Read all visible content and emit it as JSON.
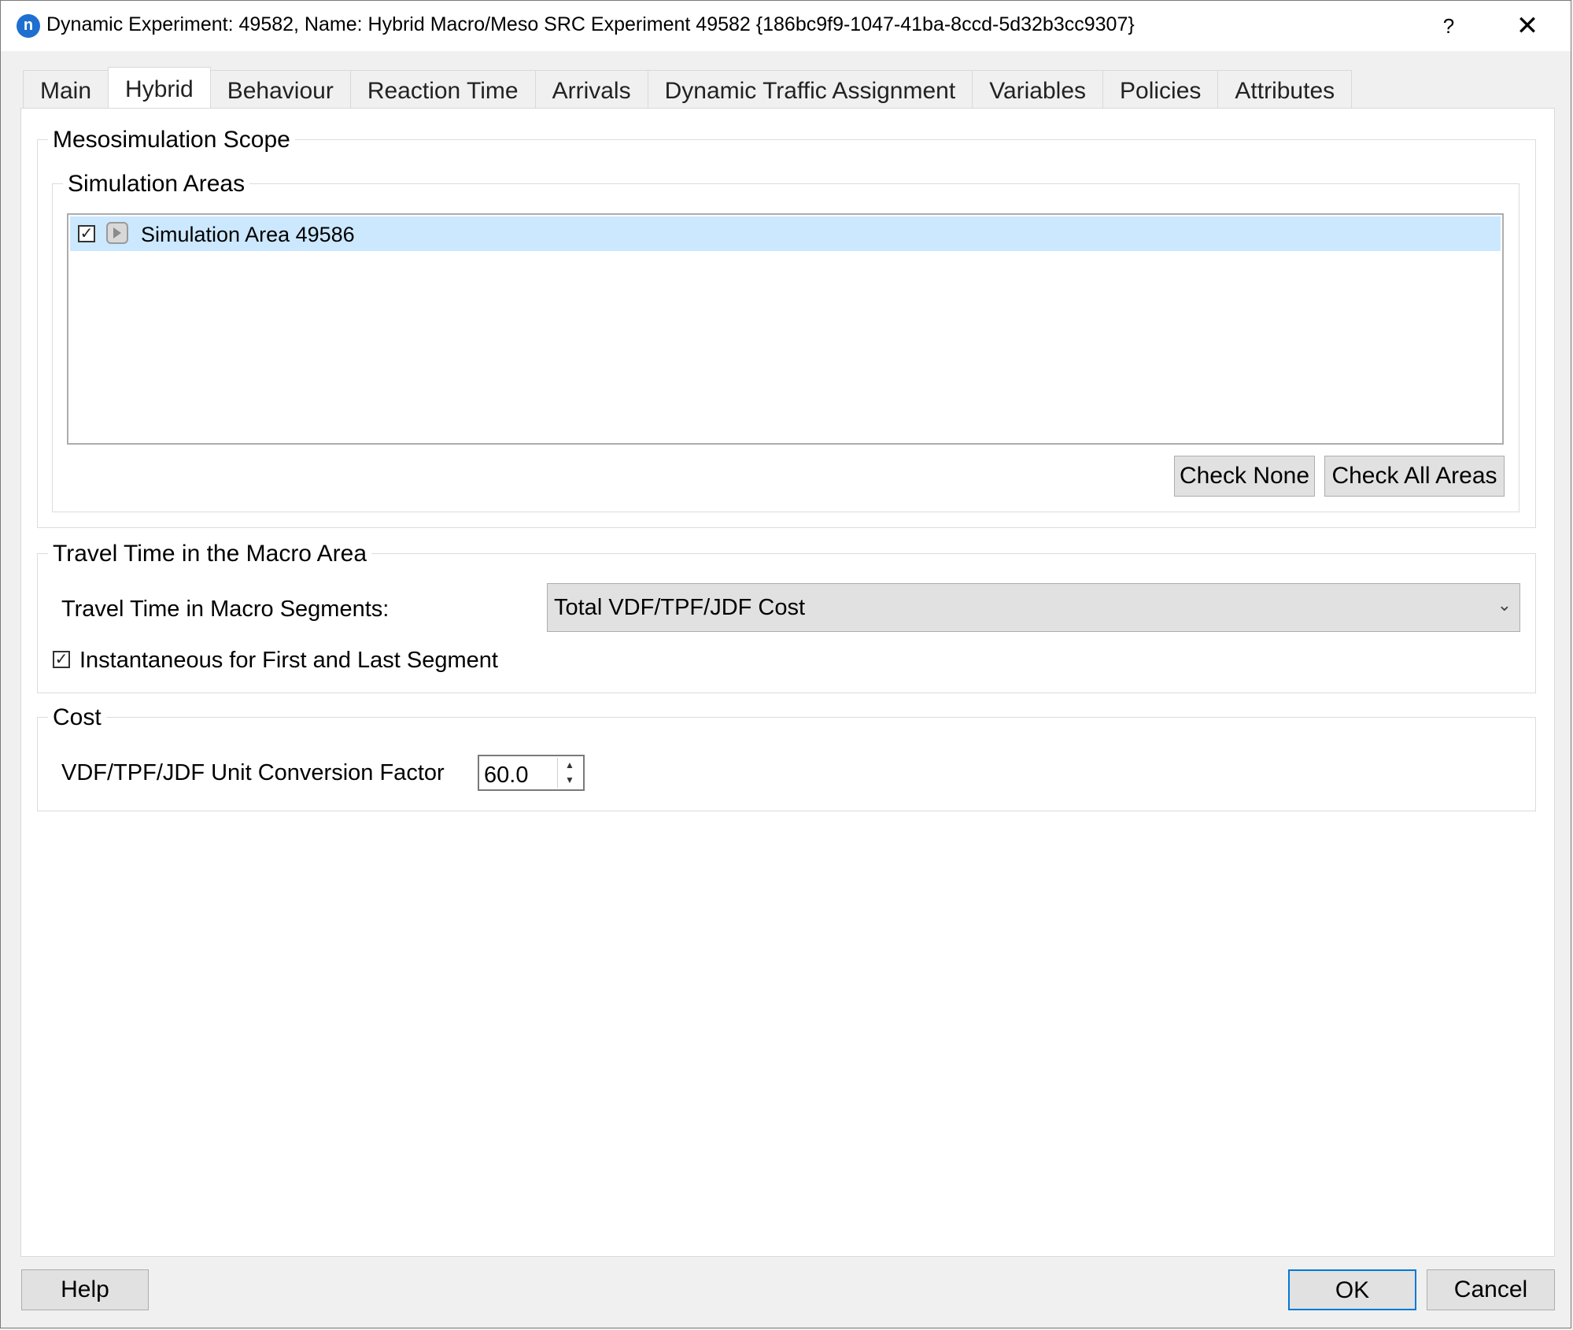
{
  "window": {
    "title": "Dynamic Experiment: 49582, Name: Hybrid Macro/Meso SRC Experiment 49582  {186bc9f9-1047-41ba-8ccd-5d32b3cc9307}",
    "app_icon_glyph": "n",
    "help_glyph": "?",
    "close_glyph": "✕"
  },
  "tabs": [
    {
      "label": "Main",
      "active": false
    },
    {
      "label": "Hybrid",
      "active": true
    },
    {
      "label": "Behaviour",
      "active": false
    },
    {
      "label": "Reaction Time",
      "active": false
    },
    {
      "label": "Arrivals",
      "active": false
    },
    {
      "label": "Dynamic Traffic Assignment",
      "active": false
    },
    {
      "label": "Variables",
      "active": false
    },
    {
      "label": "Policies",
      "active": false
    },
    {
      "label": "Attributes",
      "active": false
    }
  ],
  "meso_scope": {
    "title": "Mesosimulation Scope",
    "areas": {
      "title": "Simulation Areas",
      "items": [
        {
          "label": "Simulation Area 49586",
          "checked": true,
          "selected": true,
          "check_glyph": "✓"
        }
      ],
      "check_none_label": "Check None",
      "check_all_label": "Check All Areas"
    }
  },
  "travel_time": {
    "title": "Travel Time in the Macro Area",
    "macro_segments_label": "Travel Time in Macro Segments:",
    "macro_segments_value": "Total VDF/TPF/JDF Cost",
    "combo_arrow_glyph": "⌄",
    "instantaneous_label": "Instantaneous for First and Last Segment",
    "instantaneous_checked": true,
    "check_glyph": "✓"
  },
  "cost": {
    "title": "Cost",
    "conversion_label": "VDF/TPF/JDF Unit Conversion Factor",
    "conversion_value": "60.0",
    "spin_up_glyph": "▲",
    "spin_down_glyph": "▼"
  },
  "footer": {
    "help_label": "Help",
    "ok_label": "OK",
    "cancel_label": "Cancel"
  },
  "colors": {
    "selection": "#cce8ff",
    "accent": "#0078d7",
    "app_icon": "#1e6fd0"
  }
}
